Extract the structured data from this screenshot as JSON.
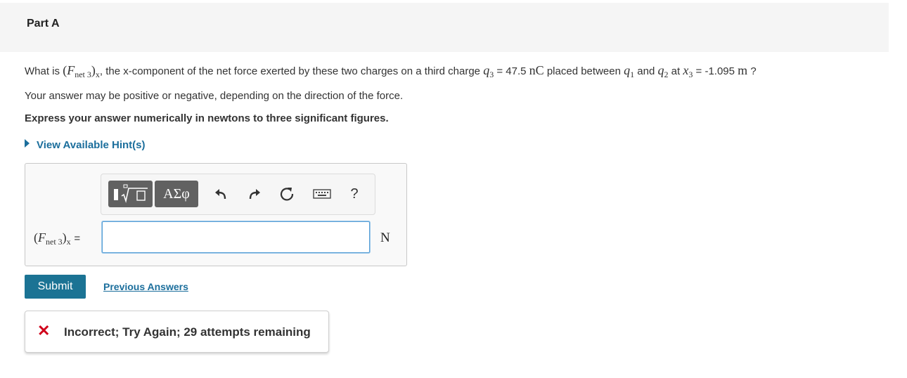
{
  "part": {
    "title": "Part A"
  },
  "question": {
    "prefix": "What is",
    "expr_F": "F",
    "expr_sub": "net 3",
    "expr_comp": "x",
    "middle": ", the x-component of the net force exerted by these two charges on a third charge",
    "q3_var": "q",
    "q3_sub": "3",
    "q3_value": "= 47.5",
    "q3_unit": "nC",
    "placed_between": "placed between",
    "q1_var": "q",
    "q1_sub": "1",
    "and": "and",
    "q2_var": "q",
    "q2_sub": "2",
    "at": "at",
    "x3_var": "x",
    "x3_sub": "3",
    "x3_value": "= -1.095",
    "x3_unit": "m",
    "end": "?"
  },
  "instructions": {
    "line1": "Your answer may be positive or negative, depending on the direction of the force.",
    "line2": "Express your answer numerically in newtons to three significant figures."
  },
  "hint": {
    "label": "View Available Hint(s)"
  },
  "toolbar": {
    "greek_label": "ΑΣφ",
    "help_label": "?",
    "icons": [
      "templates-icon",
      "greek-letters-icon",
      "undo-icon",
      "redo-icon",
      "reset-icon",
      "keyboard-icon",
      "help-icon"
    ]
  },
  "answer": {
    "label_F": "F",
    "label_sub": "net 3",
    "label_comp": "x",
    "label_eq": "=",
    "value": "",
    "unit": "N"
  },
  "actions": {
    "submit_label": "Submit",
    "previous_label": "Previous Answers"
  },
  "feedback": {
    "text": "Incorrect; Try Again; 29 attempts remaining",
    "color": "#d0021b"
  },
  "colors": {
    "accent": "#1b7394",
    "link": "#1b6e9c",
    "error": "#d0021b"
  }
}
